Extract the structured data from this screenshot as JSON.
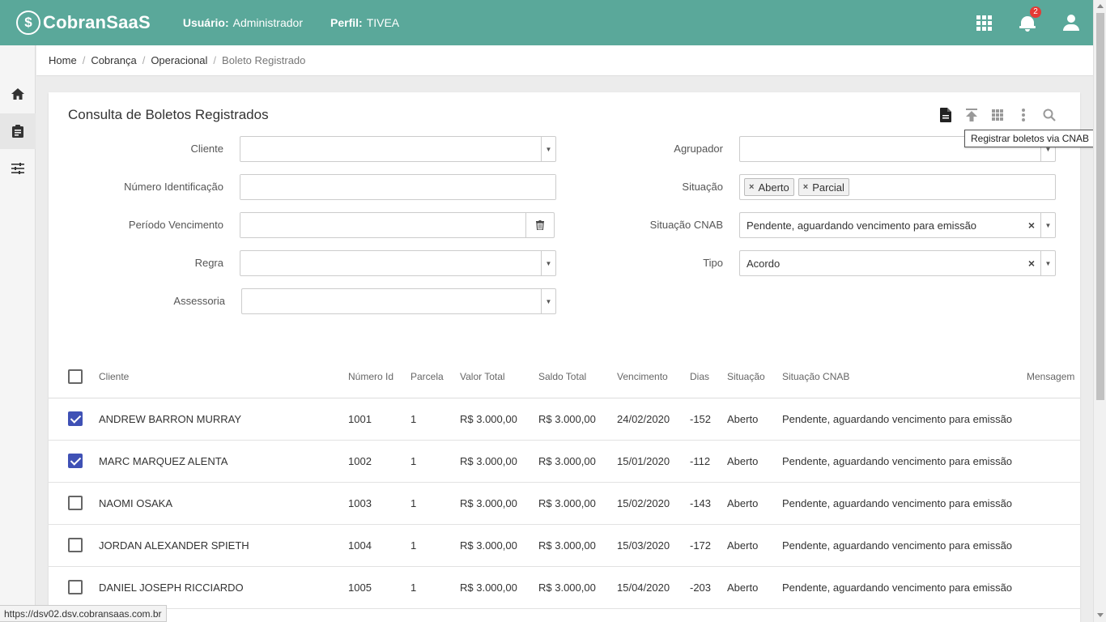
{
  "header": {
    "logo_mark": "$",
    "logo_text": "CobranSaaS",
    "user_label": "Usuário:",
    "user_value": "Administrador",
    "profile_label": "Perfil:",
    "profile_value": "TIVEA",
    "notifications_count": "2",
    "bg_color": "#5aa89a"
  },
  "sidebar": {
    "items": [
      {
        "icon": "home-icon"
      },
      {
        "icon": "clipboard-icon",
        "active": true
      },
      {
        "icon": "sliders-icon"
      }
    ]
  },
  "breadcrumb": {
    "items": [
      "Home",
      "Cobrança",
      "Operacional"
    ],
    "separator": "/",
    "current": "Boleto Registrado"
  },
  "page": {
    "title": "Consulta de Boletos Registrados",
    "tools": [
      "document-icon",
      "upload-icon",
      "grid-icon",
      "more-vert-icon",
      "search-icon"
    ],
    "tooltip": "Registrar boletos via CNAB"
  },
  "filters": {
    "cliente": {
      "label": "Cliente",
      "value": ""
    },
    "numero": {
      "label": "Número Identificação",
      "value": ""
    },
    "periodo": {
      "label": "Período Vencimento",
      "value": ""
    },
    "regra": {
      "label": "Regra",
      "value": ""
    },
    "assessoria": {
      "label": "Assessoria",
      "value": ""
    },
    "agrupador": {
      "label": "Agrupador",
      "value": ""
    },
    "situacao": {
      "label": "Situação",
      "chips": [
        "Aberto",
        "Parcial"
      ]
    },
    "situacao_cnab": {
      "label": "Situação CNAB",
      "value": "Pendente, aguardando vencimento para emissão"
    },
    "tipo": {
      "label": "Tipo",
      "value": "Acordo"
    },
    "clear_symbol": "×",
    "chip_remove_symbol": "×",
    "caret_symbol": "▼"
  },
  "table": {
    "headers": {
      "cliente": "Cliente",
      "numero": "Número Id",
      "parcela": "Parcela",
      "valor": "Valor Total",
      "saldo": "Saldo Total",
      "vencimento": "Vencimento",
      "dias": "Dias",
      "situacao": "Situação",
      "cnab": "Situação CNAB",
      "mensagem": "Mensagem"
    },
    "rows": [
      {
        "checked": true,
        "cliente": "ANDREW BARRON MURRAY",
        "numero": "1001",
        "parcela": "1",
        "valor": "R$ 3.000,00",
        "saldo": "R$ 3.000,00",
        "vencimento": "24/02/2020",
        "dias": "-152",
        "situacao": "Aberto",
        "cnab": "Pendente, aguardando vencimento para emissão"
      },
      {
        "checked": true,
        "cliente": "MARC MARQUEZ ALENTA",
        "numero": "1002",
        "parcela": "1",
        "valor": "R$ 3.000,00",
        "saldo": "R$ 3.000,00",
        "vencimento": "15/01/2020",
        "dias": "-112",
        "situacao": "Aberto",
        "cnab": "Pendente, aguardando vencimento para emissão"
      },
      {
        "checked": false,
        "cliente": "NAOMI OSAKA",
        "numero": "1003",
        "parcela": "1",
        "valor": "R$ 3.000,00",
        "saldo": "R$ 3.000,00",
        "vencimento": "15/02/2020",
        "dias": "-143",
        "situacao": "Aberto",
        "cnab": "Pendente, aguardando vencimento para emissão"
      },
      {
        "checked": false,
        "cliente": "JORDAN ALEXANDER SPIETH",
        "numero": "1004",
        "parcela": "1",
        "valor": "R$ 3.000,00",
        "saldo": "R$ 3.000,00",
        "vencimento": "15/03/2020",
        "dias": "-172",
        "situacao": "Aberto",
        "cnab": "Pendente, aguardando vencimento para emissão"
      },
      {
        "checked": false,
        "cliente": "DANIEL JOSEPH RICCIARDO",
        "numero": "1005",
        "parcela": "1",
        "valor": "R$ 3.000,00",
        "saldo": "R$ 3.000,00",
        "vencimento": "15/04/2020",
        "dias": "-203",
        "situacao": "Aberto",
        "cnab": "Pendente, aguardando vencimento para emissão"
      }
    ]
  },
  "status_url": "https://dsv02.dsv.cobransaas.com.br"
}
